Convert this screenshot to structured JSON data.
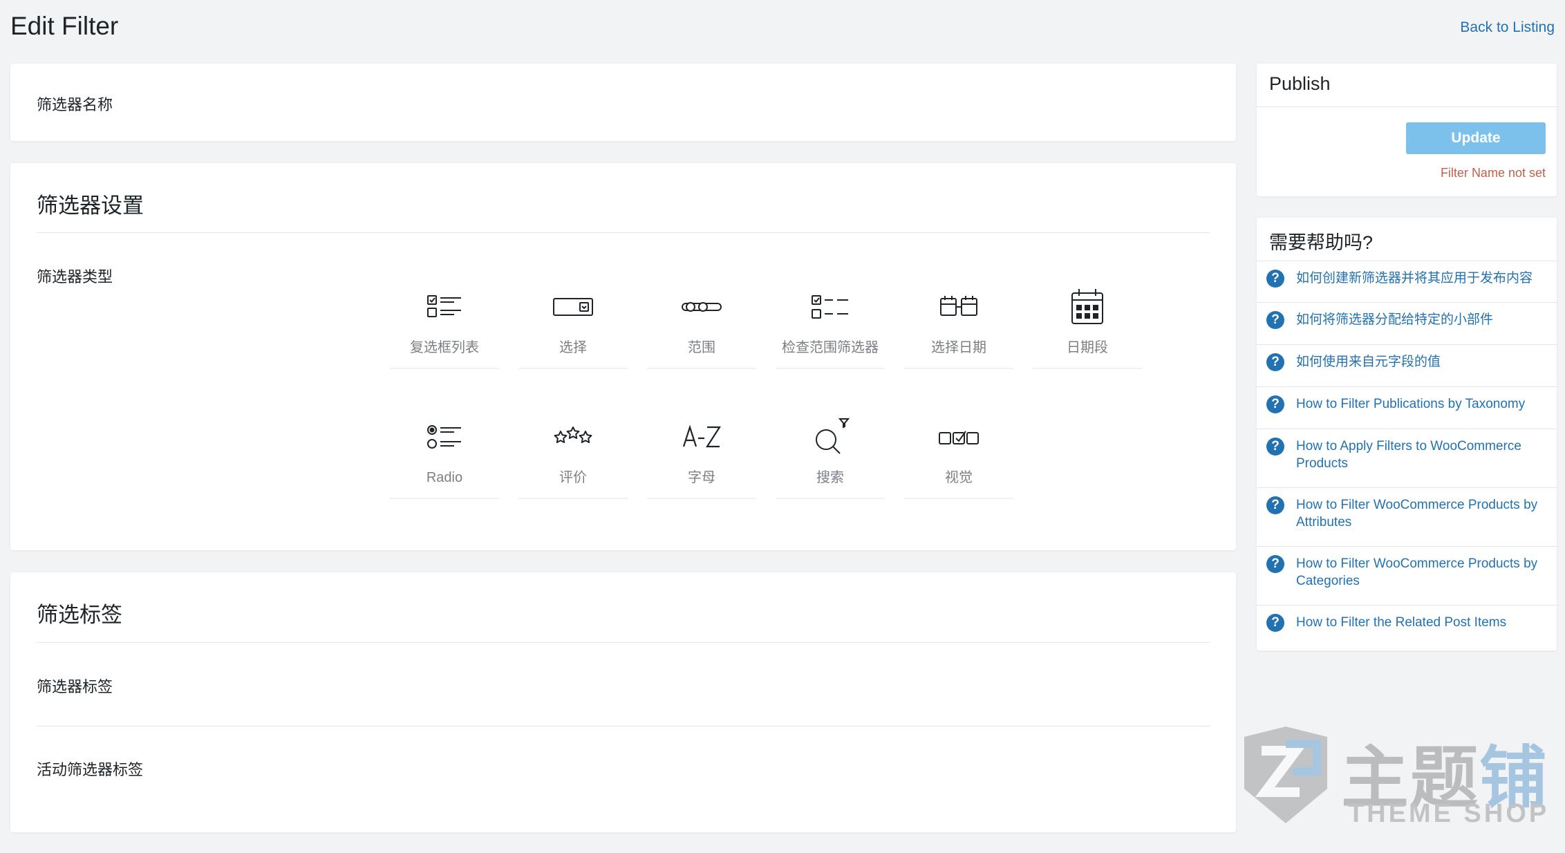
{
  "header": {
    "title": "Edit Filter",
    "back_link": "Back to Listing"
  },
  "name_card": {
    "label": "筛选器名称"
  },
  "settings": {
    "title": "筛选器设置",
    "type_label": "筛选器类型",
    "types": [
      {
        "label": "复选框列表",
        "icon": "checkbox-list-icon"
      },
      {
        "label": "选择",
        "icon": "select-icon"
      },
      {
        "label": "范围",
        "icon": "range-icon"
      },
      {
        "label": "检查范围筛选器",
        "icon": "check-range-icon"
      },
      {
        "label": "选择日期",
        "icon": "date-picker-icon"
      },
      {
        "label": "日期段",
        "icon": "date-period-icon"
      },
      {
        "label": "Radio",
        "icon": "radio-icon"
      },
      {
        "label": "评价",
        "icon": "rating-stars-icon"
      },
      {
        "label": "字母",
        "icon": "alphabet-icon"
      },
      {
        "label": "搜索",
        "icon": "search-icon"
      },
      {
        "label": "视觉",
        "icon": "visual-icon"
      }
    ]
  },
  "labels": {
    "title": "筛选标签",
    "filter_label": "筛选器标签",
    "active_label": "活动筛选器标签"
  },
  "publish": {
    "title": "Publish",
    "button": "Update",
    "error": "Filter Name not set"
  },
  "help": {
    "title": "需要帮助吗?",
    "items": [
      "如何创建新筛选器并将其应用于发布内容",
      "如何将筛选器分配给特定的小部件",
      "如何使用来自元字段的值",
      "How to Filter Publications by Taxonomy",
      "How to Apply Filters to WooCommerce Products",
      "How to Filter WooCommerce Products by Attributes",
      "How to Filter WooCommerce Products by Categories",
      "How to Filter the Related Post Items"
    ]
  },
  "watermark": {
    "cn": "主题",
    "cn_blue": "铺",
    "en": "THEME SHOP"
  },
  "colors": {
    "accent": "#2271b1",
    "button_disabled": "#7cc1ec",
    "error": "#c0604a",
    "background": "#f2f3f5"
  }
}
